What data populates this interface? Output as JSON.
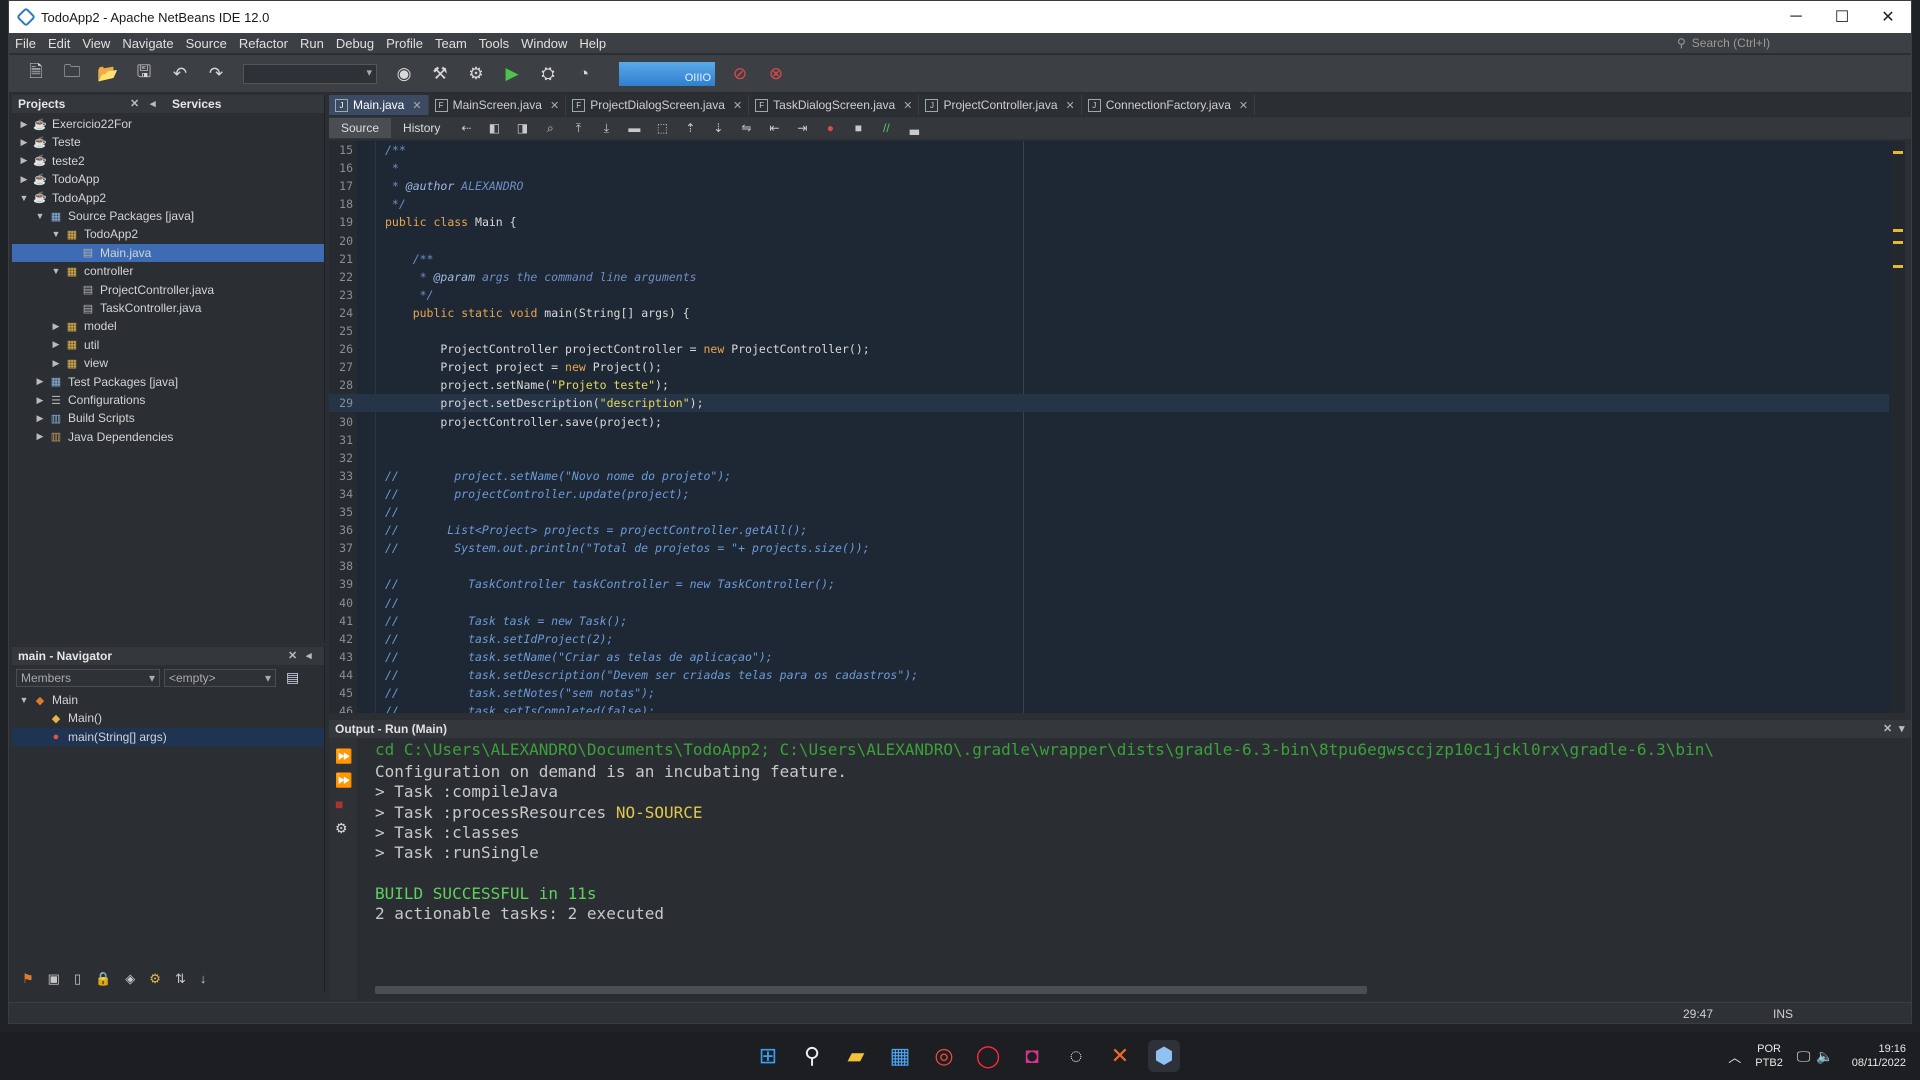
{
  "window": {
    "title": "TodoApp2 - Apache NetBeans IDE 12.0",
    "controls": [
      "─",
      "☐",
      "✕"
    ]
  },
  "menu": {
    "items": [
      "File",
      "Edit",
      "View",
      "Navigate",
      "Source",
      "Refactor",
      "Run",
      "Debug",
      "Profile",
      "Team",
      "Tools",
      "Window",
      "Help"
    ],
    "search_placeholder": "Search (Ctrl+I)"
  },
  "toolbar": {
    "memory_label": "OIIIO"
  },
  "projects_panel": {
    "title": "Projects",
    "services_tab": "Services",
    "tree": [
      {
        "label": "Exercicio22For",
        "level": 0,
        "toggle": "▶",
        "icon": "project-icon",
        "glyph": "☕"
      },
      {
        "label": "Teste",
        "level": 0,
        "toggle": "▶",
        "icon": "project-icon",
        "glyph": "☕"
      },
      {
        "label": "teste2",
        "level": 0,
        "toggle": "▶",
        "icon": "project-icon",
        "glyph": "☕"
      },
      {
        "label": "TodoApp",
        "level": 0,
        "toggle": "▶",
        "icon": "project-icon",
        "glyph": "☕"
      },
      {
        "label": "TodoApp2",
        "level": 0,
        "toggle": "▼",
        "icon": "project-icon",
        "glyph": "☕"
      },
      {
        "label": "Source Packages [java]",
        "level": 1,
        "toggle": "▼",
        "icon": "folder-icon",
        "glyph": "▦"
      },
      {
        "label": "TodoApp2",
        "level": 2,
        "toggle": "▼",
        "icon": "package-icon",
        "glyph": "▦"
      },
      {
        "label": "Main.java",
        "level": 3,
        "toggle": "",
        "icon": "java-file-icon",
        "glyph": "▤",
        "selected": true
      },
      {
        "label": "controller",
        "level": 2,
        "toggle": "▼",
        "icon": "package-icon",
        "glyph": "▦"
      },
      {
        "label": "ProjectController.java",
        "level": 3,
        "toggle": "",
        "icon": "java-file-icon",
        "glyph": "▤"
      },
      {
        "label": "TaskController.java",
        "level": 3,
        "toggle": "",
        "icon": "java-file-icon",
        "glyph": "▤"
      },
      {
        "label": "model",
        "level": 2,
        "toggle": "▶",
        "icon": "package-icon",
        "glyph": "▦"
      },
      {
        "label": "util",
        "level": 2,
        "toggle": "▶",
        "icon": "package-icon",
        "glyph": "▦"
      },
      {
        "label": "view",
        "level": 2,
        "toggle": "▶",
        "icon": "package-icon",
        "glyph": "▦"
      },
      {
        "label": "Test Packages [java]",
        "level": 1,
        "toggle": "▶",
        "icon": "folder-icon",
        "glyph": "▦"
      },
      {
        "label": "Configurations",
        "level": 1,
        "toggle": "▶",
        "icon": "configurations-icon",
        "glyph": "☰"
      },
      {
        "label": "Build Scripts",
        "level": 1,
        "toggle": "▶",
        "icon": "build-scripts-icon",
        "glyph": "▥"
      },
      {
        "label": "Java Dependencies",
        "level": 1,
        "toggle": "▶",
        "icon": "library-icon",
        "glyph": "▥"
      }
    ]
  },
  "navigator": {
    "title": "main - Navigator",
    "filter": "Members",
    "empty_combo": "<empty>",
    "tree": [
      {
        "label": "Main",
        "level": 0,
        "toggle": "▼",
        "icon": "class-icon",
        "glyph": "◆"
      },
      {
        "label": "Main()",
        "level": 1,
        "toggle": "",
        "icon": "constructor-icon",
        "glyph": "◆"
      },
      {
        "label": "main(String[] args)",
        "level": 1,
        "toggle": "",
        "icon": "method-icon",
        "glyph": "●",
        "selected": true
      }
    ]
  },
  "editor": {
    "tabs": [
      {
        "label": "Main.java",
        "active": true
      },
      {
        "label": "MainScreen.java",
        "active": false
      },
      {
        "label": "ProjectDialogScreen.java",
        "active": false
      },
      {
        "label": "TaskDialogScreen.java",
        "active": false
      },
      {
        "label": "ProjectController.java",
        "active": false
      },
      {
        "label": "ConnectionFactory.java",
        "active": false
      }
    ],
    "source_label": "Source",
    "history_label": "History",
    "current_line": 29,
    "lines": [
      {
        "n": "15",
        "code": "/**",
        "type": "doc"
      },
      {
        "n": "16",
        "code": " *",
        "type": "doc"
      },
      {
        "n": "17",
        "code": " * @author ALEXANDRO",
        "type": "doc"
      },
      {
        "n": "18",
        "code": " */",
        "type": "doc"
      },
      {
        "n": "19",
        "code": "public class Main {",
        "type": "code"
      },
      {
        "n": "20",
        "code": "",
        "type": "code"
      },
      {
        "n": "21",
        "code": "    /**",
        "type": "doc"
      },
      {
        "n": "22",
        "code": "     * @param args the command line arguments",
        "type": "doc"
      },
      {
        "n": "23",
        "code": "     */",
        "type": "doc"
      },
      {
        "n": "24",
        "code": "    public static void main(String[] args) {",
        "type": "code"
      },
      {
        "n": "25",
        "code": "",
        "type": "code"
      },
      {
        "n": "26",
        "code": "        ProjectController projectController = new ProjectController();",
        "type": "code"
      },
      {
        "n": "27",
        "code": "        Project project = new Project();",
        "type": "code"
      },
      {
        "n": "28",
        "code": "        project.setName(\"Projeto teste\");",
        "type": "code"
      },
      {
        "n": "29",
        "code": "        project.setDescription(\"description\");",
        "type": "code"
      },
      {
        "n": "30",
        "code": "        projectController.save(project);",
        "type": "code"
      },
      {
        "n": "31",
        "code": "",
        "type": "code"
      },
      {
        "n": "32",
        "code": "",
        "type": "code"
      },
      {
        "n": "33",
        "code": "//        project.setName(\"Novo nome do projeto\");",
        "type": "comment"
      },
      {
        "n": "34",
        "code": "//        projectController.update(project);",
        "type": "comment"
      },
      {
        "n": "35",
        "code": "//",
        "type": "comment"
      },
      {
        "n": "36",
        "code": "//       List<Project> projects = projectController.getAll();",
        "type": "comment"
      },
      {
        "n": "37",
        "code": "//        System.out.println(\"Total de projetos = \"+ projects.size());",
        "type": "comment"
      },
      {
        "n": "38",
        "code": "",
        "type": "code"
      },
      {
        "n": "39",
        "code": "//          TaskController taskController = new TaskController();",
        "type": "comment"
      },
      {
        "n": "40",
        "code": "//",
        "type": "comment"
      },
      {
        "n": "41",
        "code": "//          Task task = new Task();",
        "type": "comment"
      },
      {
        "n": "42",
        "code": "//          task.setIdProject(2);",
        "type": "comment"
      },
      {
        "n": "43",
        "code": "//          task.setName(\"Criar as telas de aplicaçao\");",
        "type": "comment"
      },
      {
        "n": "44",
        "code": "//          task.setDescription(\"Devem ser criadas telas para os cadastros\");",
        "type": "comment"
      },
      {
        "n": "45",
        "code": "//          task.setNotes(\"sem notas\");",
        "type": "comment"
      },
      {
        "n": "46",
        "code": "//          task.setIsCompleted(false);",
        "type": "comment"
      }
    ]
  },
  "output": {
    "title": "Output - Run (Main)",
    "command": "cd C:\\Users\\ALEXANDRO\\Documents\\TodoApp2; C:\\Users\\ALEXANDRO\\.gradle\\wrapper\\dists\\gradle-6.3-bin\\8tpu6egwsccjzp10c1jckl0rx\\gradle-6.3\\bin\\",
    "lines": [
      {
        "text": "Configuration on demand is an incubating feature.",
        "extra": "",
        "type": "normal"
      },
      {
        "text": "> Task :compileJava",
        "extra": "",
        "type": "normal"
      },
      {
        "text": "> Task :processResources ",
        "extra": "NO-SOURCE",
        "type": "normal"
      },
      {
        "text": "> Task :classes",
        "extra": "",
        "type": "normal"
      },
      {
        "text": "> Task :runSingle",
        "extra": "",
        "type": "normal"
      },
      {
        "text": "",
        "extra": "",
        "type": "normal"
      },
      {
        "text": "BUILD SUCCESSFUL in 11s",
        "extra": "",
        "type": "ok"
      },
      {
        "text": "2 actionable tasks: 2 executed",
        "extra": "",
        "type": "normal"
      }
    ]
  },
  "status": {
    "position": "29:47",
    "mode": "INS"
  },
  "taskbar": {
    "language_top": "POR",
    "language_bottom": "PTB2",
    "time": "19:16",
    "date": "08/11/2022"
  },
  "colors": {
    "editor_bg": "#1e2734",
    "keyword": "#e8a64b",
    "string": "#e8d75a",
    "comment": "#6c9bd8",
    "selection": "#3d6cb5",
    "build_success": "#5ed15e"
  }
}
